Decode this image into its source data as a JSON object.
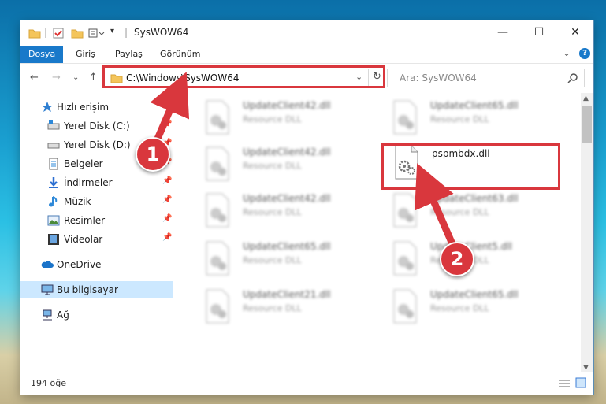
{
  "window": {
    "title": "SysWOW64",
    "controls": {
      "minimize": "—",
      "maximize": "☐",
      "close": "✕"
    }
  },
  "ribbon": {
    "tabs": [
      "Dosya",
      "Giriş",
      "Paylaş",
      "Görünüm"
    ],
    "collapse_glyph": "⌄",
    "help_glyph": "?"
  },
  "navigation": {
    "back": "←",
    "forward": "→",
    "recent": "⌄",
    "up": "↑",
    "address_path": "C:\\Windows\\SysWOW64",
    "refresh": "↻",
    "dropdown": "⌄",
    "search_placeholder": "Ara: SysWOW64",
    "search_icon": "search-icon"
  },
  "sidebar": {
    "items": [
      {
        "label": "Hızlı erişim",
        "icon": "star-icon",
        "pinned": false
      },
      {
        "label": "Yerel Disk (C:)",
        "icon": "drive-icon",
        "pinned": true
      },
      {
        "label": "Yerel Disk (D:)",
        "icon": "drive-icon",
        "pinned": true
      },
      {
        "label": "Belgeler",
        "icon": "documents-icon",
        "pinned": true
      },
      {
        "label": "İndirmeler",
        "icon": "download-icon",
        "pinned": true
      },
      {
        "label": "Müzik",
        "icon": "music-icon",
        "pinned": true
      },
      {
        "label": "Resimler",
        "icon": "pictures-icon",
        "pinned": true
      },
      {
        "label": "Videolar",
        "icon": "videos-icon",
        "pinned": true
      },
      {
        "label": "OneDrive",
        "icon": "cloud-icon",
        "pinned": false
      },
      {
        "label": "Bu bilgisayar",
        "icon": "computer-icon",
        "pinned": false
      },
      {
        "label": "Ağ",
        "icon": "network-icon",
        "pinned": false
      }
    ],
    "pin_glyph": "📌"
  },
  "files": [
    {
      "name": "UpdateClient42.dll",
      "type": "Resource DLL",
      "blurred": true
    },
    {
      "name": "UpdateClient65.dll",
      "type": "Resource DLL",
      "blurred": true
    },
    {
      "name": "UpdateClient42.dll",
      "type": "Resource DLL",
      "blurred": true
    },
    {
      "name": "pspmbdx.dll",
      "type": "",
      "blurred": false
    },
    {
      "name": "UpdateClient42.dll",
      "type": "Resource DLL",
      "blurred": true
    },
    {
      "name": "UpdateClient63.dll",
      "type": "Resource DLL",
      "blurred": true
    },
    {
      "name": "UpdateClient65.dll",
      "type": "Resource DLL",
      "blurred": true
    },
    {
      "name": "UpdateClient5.dll",
      "type": "Resource DLL",
      "blurred": true
    },
    {
      "name": "UpdateClient21.dll",
      "type": "Resource DLL",
      "blurred": true
    },
    {
      "name": "UpdateClient65.dll",
      "type": "Resource DLL",
      "blurred": true
    }
  ],
  "status": {
    "count": "194 öğe"
  },
  "annotations": {
    "step1": "1",
    "step2": "2",
    "highlight_color": "#d9373d"
  }
}
